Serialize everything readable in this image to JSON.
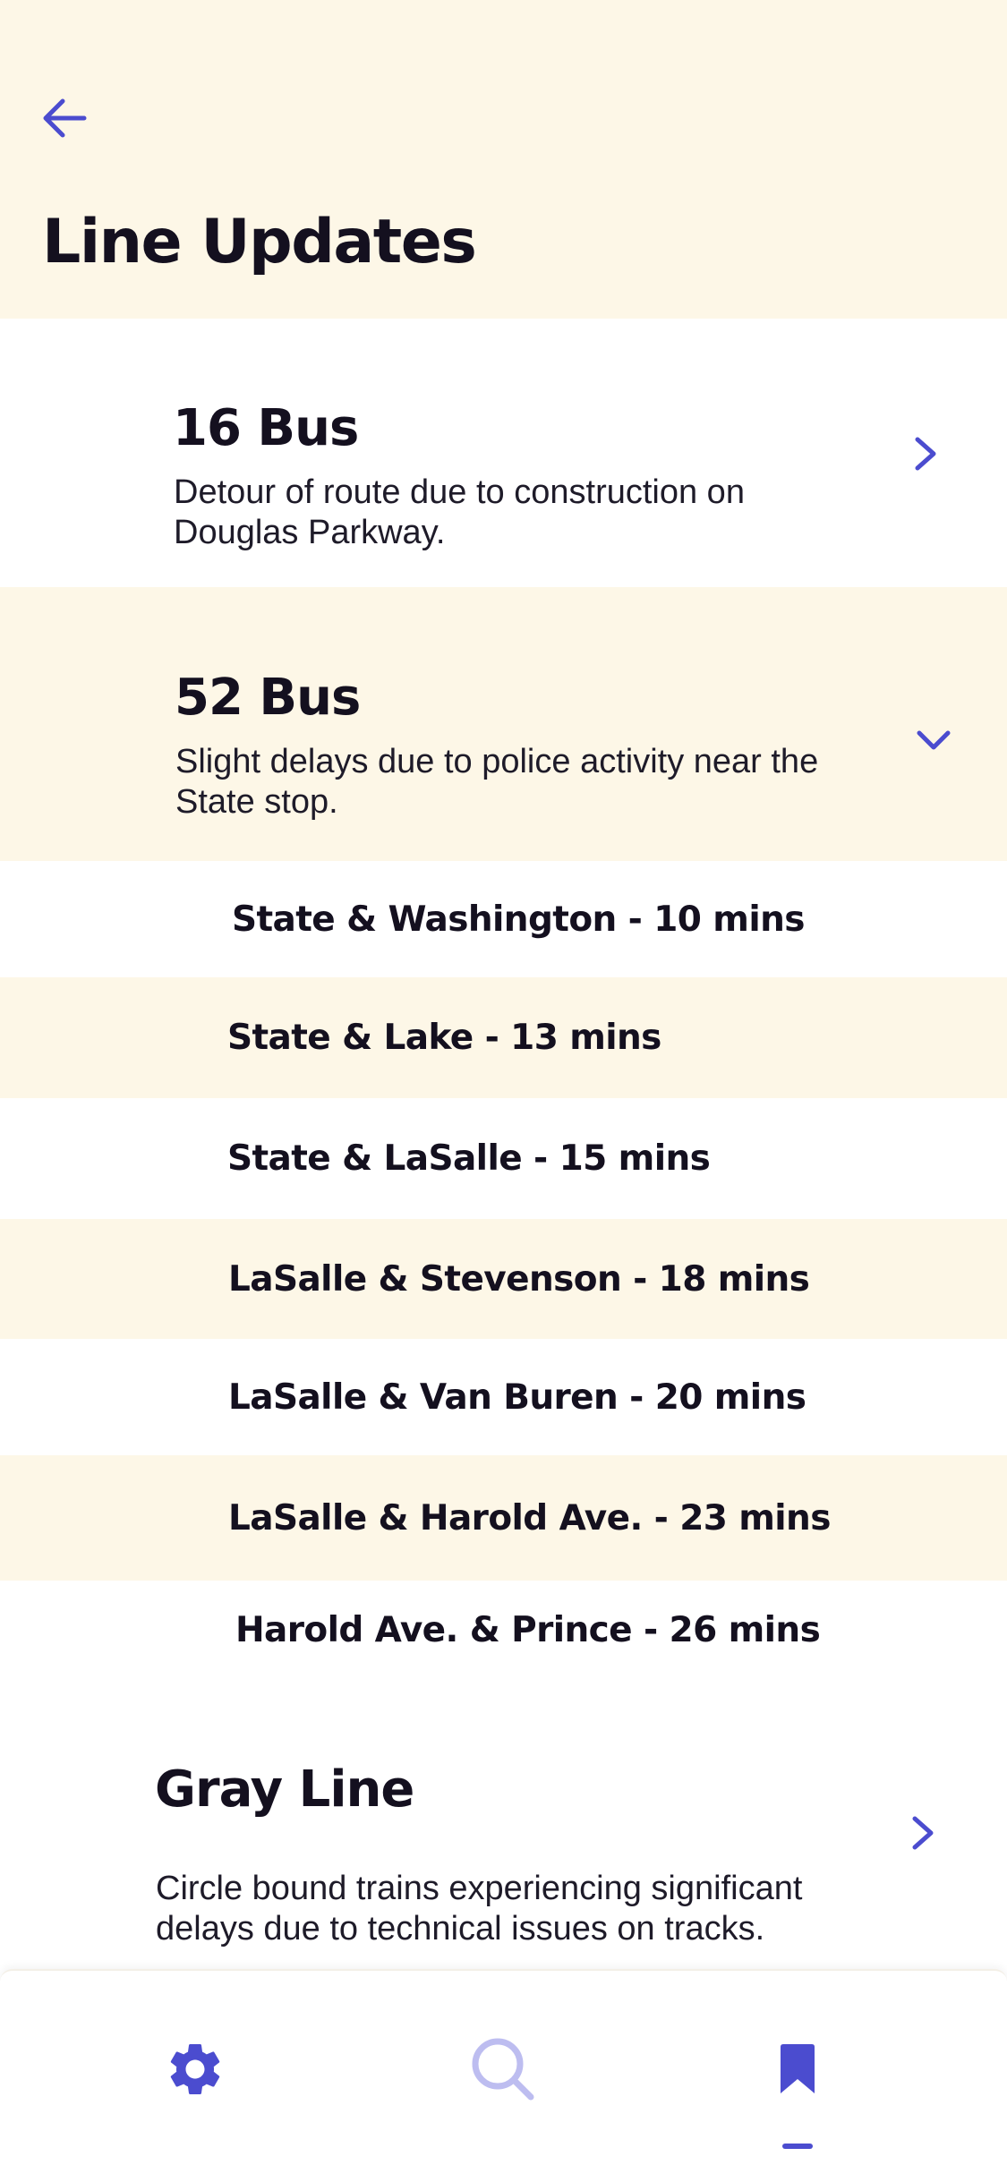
{
  "header": {
    "back_icon": "arrow-left-icon",
    "title": "Line Updates"
  },
  "colors": {
    "accent": "#4b4ccf",
    "accent_light": "#bdbdf0",
    "cream": "#fdf7e7",
    "text": "#14101f"
  },
  "updates": [
    {
      "title": "16 Bus",
      "description_lines": [
        "Detour of route due to construction on",
        "Douglas Parkway."
      ],
      "icon": "chevron-right-icon",
      "expanded": false
    },
    {
      "title": "52 Bus",
      "description_lines": [
        "Slight delays due to police activity near the",
        "State stop."
      ],
      "icon": "chevron-down-icon",
      "expanded": true,
      "stops": [
        "State & Washington - 10 mins",
        "State &  Lake - 13 mins",
        "State & LaSalle - 15 mins",
        "LaSalle & Stevenson - 18 mins",
        "LaSalle & Van Buren - 20 mins",
        "LaSalle & Harold Ave. - 23 mins",
        "Harold Ave. & Prince - 26 mins"
      ]
    },
    {
      "title": "Gray Line",
      "description_lines": [
        "Circle bound trains experiencing significant",
        "delays due to technical issues on tracks."
      ],
      "icon": "chevron-right-icon",
      "expanded": false
    }
  ],
  "tabbar": {
    "tabs": [
      {
        "icon": "gear-icon",
        "active": false
      },
      {
        "icon": "search-icon",
        "active": false
      },
      {
        "icon": "bookmark-icon",
        "active": true
      }
    ]
  }
}
